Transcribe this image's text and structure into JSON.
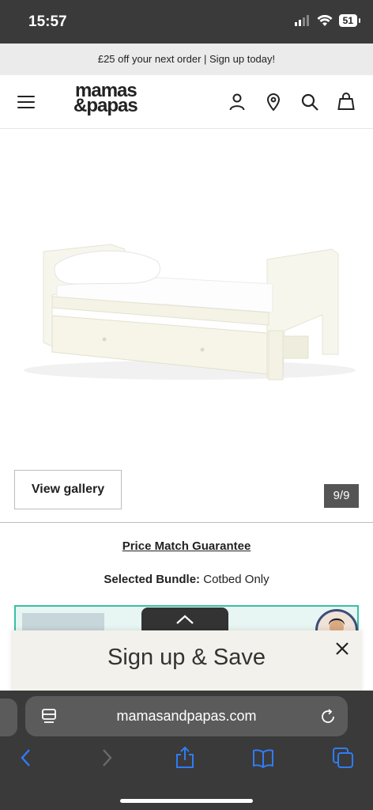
{
  "status_bar": {
    "time": "15:57",
    "battery": "51"
  },
  "promo": {
    "text": "£25 off your next order | Sign up today!"
  },
  "header": {
    "logo_line1": "mamas",
    "logo_line2": "&papas",
    "icons": [
      "menu-icon",
      "account-icon",
      "store-locator-icon",
      "search-icon",
      "basket-icon"
    ]
  },
  "gallery": {
    "view_gallery_label": "View gallery",
    "counter": "9/9"
  },
  "product": {
    "price_match_label": "Price Match Guarantee",
    "bundle_label": "Selected Bundle:",
    "bundle_value": "Cotbed Only"
  },
  "signup": {
    "title": "Sign up & Save"
  },
  "browser": {
    "url": "mamasandpapas.com"
  },
  "colors": {
    "accent_teal": "#3bbfa4",
    "toolbar_blue": "#2f7cf6",
    "dark_bar": "#3a3a3a"
  }
}
